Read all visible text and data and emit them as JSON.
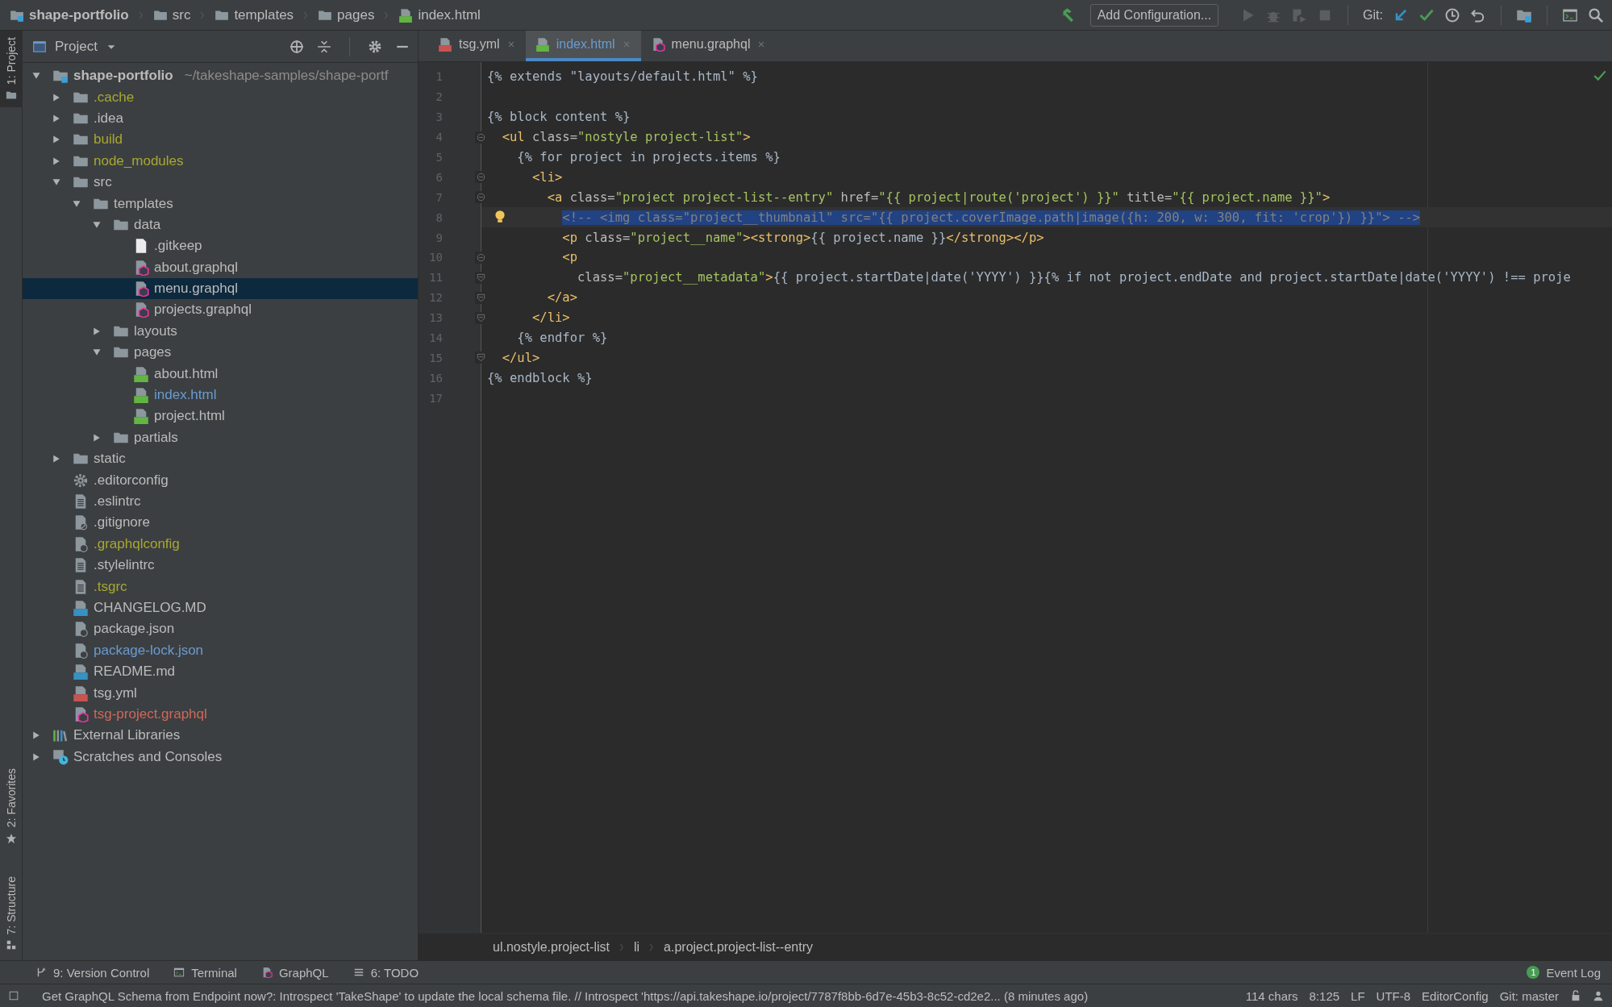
{
  "navbar": {
    "breadcrumbs": [
      {
        "label": "shape-portfolio",
        "kind": "project"
      },
      {
        "label": "src",
        "kind": "folder"
      },
      {
        "label": "templates",
        "kind": "folder"
      },
      {
        "label": "pages",
        "kind": "folder"
      },
      {
        "label": "index.html",
        "kind": "html"
      }
    ],
    "run_config": "Add Configuration...",
    "git_label": "Git:"
  },
  "tool_strip": [
    {
      "label": "1: Project",
      "kind": "project",
      "selected": true
    },
    {
      "label": "2: Favorites",
      "kind": "favorites",
      "selected": false
    },
    {
      "label": "7: Structure",
      "kind": "structure",
      "selected": false
    }
  ],
  "project_panel": {
    "title": "Project",
    "tree": [
      {
        "label": "shape-portfolio",
        "path": "~/takeshape-samples/shape-portf",
        "kind": "module",
        "expanded": true,
        "selected": false,
        "children": [
          {
            "label": ".cache",
            "kind": "folder",
            "color": "#a8a830",
            "expanded": false,
            "selected": false
          },
          {
            "label": ".idea",
            "kind": "folder",
            "expanded": false,
            "selected": false
          },
          {
            "label": "build",
            "kind": "folder",
            "color": "#a8a830",
            "expanded": false,
            "selected": false
          },
          {
            "label": "node_modules",
            "kind": "folder",
            "color": "#a8a830",
            "expanded": false,
            "selected": false
          },
          {
            "label": "src",
            "kind": "folder",
            "expanded": true,
            "selected": false,
            "children": [
              {
                "label": "templates",
                "kind": "folder",
                "expanded": true,
                "selected": false,
                "children": [
                  {
                    "label": "data",
                    "kind": "folder",
                    "expanded": true,
                    "selected": false,
                    "children": [
                      {
                        "label": ".gitkeep",
                        "kind": "file",
                        "selected": false
                      },
                      {
                        "label": "about.graphql",
                        "kind": "graphql",
                        "selected": false
                      },
                      {
                        "label": "menu.graphql",
                        "kind": "graphql",
                        "selected": true
                      },
                      {
                        "label": "projects.graphql",
                        "kind": "graphql",
                        "selected": false
                      }
                    ]
                  },
                  {
                    "label": "layouts",
                    "kind": "folder",
                    "expanded": false,
                    "selected": false
                  },
                  {
                    "label": "pages",
                    "kind": "folder",
                    "expanded": true,
                    "selected": false,
                    "children": [
                      {
                        "label": "about.html",
                        "kind": "html",
                        "selected": false
                      },
                      {
                        "label": "index.html",
                        "kind": "html",
                        "color": "#6a9bd1",
                        "selected": false
                      },
                      {
                        "label": "project.html",
                        "kind": "html",
                        "selected": false
                      }
                    ]
                  },
                  {
                    "label": "partials",
                    "kind": "folder",
                    "expanded": false,
                    "selected": false
                  }
                ]
              }
            ]
          },
          {
            "label": "static",
            "kind": "folder",
            "expanded": false,
            "selected": false
          },
          {
            "label": ".editorconfig",
            "kind": "settings",
            "selected": false
          },
          {
            "label": ".eslintrc",
            "kind": "text",
            "selected": false
          },
          {
            "label": ".gitignore",
            "kind": "ignore",
            "selected": false
          },
          {
            "label": ".graphqlconfig",
            "kind": "config",
            "color": "#a8a830",
            "selected": false
          },
          {
            "label": ".stylelintrc",
            "kind": "text",
            "selected": false
          },
          {
            "label": ".tsgrc",
            "kind": "text",
            "color": "#a8a830",
            "selected": false
          },
          {
            "label": "CHANGELOG.MD",
            "kind": "markdown",
            "selected": false
          },
          {
            "label": "package.json",
            "kind": "config",
            "selected": false
          },
          {
            "label": "package-lock.json",
            "kind": "config",
            "color": "#6a9bd1",
            "selected": false
          },
          {
            "label": "README.md",
            "kind": "markdown",
            "selected": false
          },
          {
            "label": "tsg.yml",
            "kind": "yaml",
            "selected": false
          },
          {
            "label": "tsg-project.graphql",
            "kind": "graphql",
            "color": "#d1675a",
            "selected": false
          }
        ]
      },
      {
        "label": "External Libraries",
        "kind": "libraries",
        "expanded": false,
        "selected": false
      },
      {
        "label": "Scratches and Consoles",
        "kind": "scratches",
        "expanded": false,
        "selected": false
      }
    ]
  },
  "tabs": [
    {
      "label": "tsg.yml",
      "kind": "yaml",
      "selected": false
    },
    {
      "label": "index.html",
      "kind": "html",
      "selected": true
    },
    {
      "label": "menu.graphql",
      "kind": "graphql",
      "selected": false
    }
  ],
  "editor": {
    "lines": [
      {
        "number": "1",
        "segments": [
          {
            "kind": "text",
            "text": "{% extends \"layouts/default.html\" %}"
          }
        ]
      },
      {
        "number": "2"
      },
      {
        "number": "3",
        "segments": [
          {
            "kind": "text",
            "text": "{% block content %}"
          }
        ]
      },
      {
        "number": "4",
        "fold_start": true,
        "segments": [
          {
            "kind": "tag",
            "text": "  <ul "
          },
          {
            "kind": "attr",
            "text": "class="
          },
          {
            "kind": "value",
            "text": "\"nostyle project-list\""
          },
          {
            "kind": "tag",
            "text": ">"
          }
        ]
      },
      {
        "number": "5",
        "segments": [
          {
            "kind": "text",
            "text": "    {% for project in projects.items %}"
          }
        ]
      },
      {
        "number": "6",
        "fold_start": true,
        "segments": [
          {
            "kind": "tag",
            "text": "      <li>"
          }
        ]
      },
      {
        "number": "7",
        "fold_start": true,
        "segments": [
          {
            "kind": "tag",
            "text": "        <a "
          },
          {
            "kind": "attr",
            "text": "class="
          },
          {
            "kind": "value",
            "text": "\"project project-list--entry\""
          },
          {
            "kind": "attr",
            "text": " href="
          },
          {
            "kind": "value",
            "text": "\"{{ project|route('project') }}\""
          },
          {
            "kind": "attr",
            "text": " title="
          },
          {
            "kind": "value",
            "text": "\"{{ project.name }}\""
          },
          {
            "kind": "tag",
            "text": ">"
          }
        ]
      },
      {
        "number": "8",
        "selected": true,
        "bulb": true,
        "segments": [
          {
            "kind": "comment",
            "text": "          <!-- <img class=\"project__thumbnail\" src=\"{{ project.coverImage.path|image({h: 200, w: 300, fit: 'crop'}) }}\"> -->"
          }
        ]
      },
      {
        "number": "9",
        "segments": [
          {
            "kind": "tag",
            "text": "          <p "
          },
          {
            "kind": "attr",
            "text": "class="
          },
          {
            "kind": "value",
            "text": "\"project__name\""
          },
          {
            "kind": "tag",
            "text": "><strong>"
          },
          {
            "kind": "text",
            "text": "{{ project.name }}"
          },
          {
            "kind": "tag",
            "text": "</strong></p>"
          }
        ]
      },
      {
        "number": "10",
        "fold_start": true,
        "segments": [
          {
            "kind": "tag",
            "text": "          <p"
          }
        ]
      },
      {
        "number": "11",
        "fold_end": true,
        "segments": [
          {
            "kind": "attr",
            "text": "            class="
          },
          {
            "kind": "value",
            "text": "\"project__metadata\""
          },
          {
            "kind": "tag",
            "text": ">"
          },
          {
            "kind": "text",
            "text": "{{ project.startDate|date('YYYY') }}{% if not project.endDate and project.startDate|date('YYYY') !== proje"
          }
        ]
      },
      {
        "number": "12",
        "fold_end": true,
        "segments": [
          {
            "kind": "tag",
            "text": "        </a>"
          }
        ]
      },
      {
        "number": "13",
        "fold_end": true,
        "segments": [
          {
            "kind": "tag",
            "text": "      </li>"
          }
        ]
      },
      {
        "number": "14",
        "segments": [
          {
            "kind": "text",
            "text": "    {% endfor %}"
          }
        ]
      },
      {
        "number": "15",
        "fold_end": true,
        "segments": [
          {
            "kind": "tag",
            "text": "  </ul>"
          }
        ]
      },
      {
        "number": "16",
        "segments": [
          {
            "kind": "text",
            "text": "{% endblock %}"
          }
        ]
      },
      {
        "number": "17"
      }
    ],
    "breadcrumbs": [
      "ul.nostyle.project-list",
      "li",
      "a.project.project-list--entry"
    ]
  },
  "tool_windows": [
    {
      "label": "9: Version Control",
      "kind": "vcs"
    },
    {
      "label": "Terminal",
      "kind": "terminal"
    },
    {
      "label": "GraphQL",
      "kind": "graphql"
    },
    {
      "label": "6: TODO",
      "kind": "todo"
    }
  ],
  "event_log": {
    "label": "Event Log",
    "badge": "1"
  },
  "status_bar": {
    "message": "Get GraphQL Schema from Endpoint now?: Introspect 'TakeShape' to update the local schema file. // Introspect 'https://api.takeshape.io/project/7787f8bb-6d7e-45b3-8c52-cd2e2... (8 minutes ago)",
    "items": [
      "114 chars",
      "8:125",
      "LF",
      "UTF-8",
      "EditorConfig",
      "Git: master"
    ]
  }
}
